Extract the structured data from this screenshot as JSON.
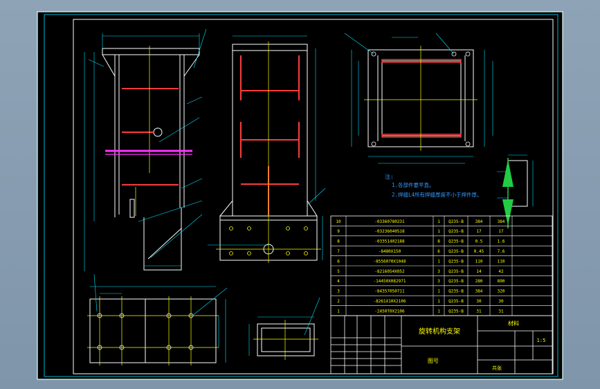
{
  "drawing": {
    "title_cn": "旋转机构支架",
    "drawing_no_label": "图号",
    "material_label": "材料",
    "scale_value": "1:5",
    "sheet_label": "共张",
    "notes_heading": "注:",
    "notes": [
      "1.各部件要平直。",
      "2.焊缝L4所有焊缝厚度不小于焊件厚。"
    ]
  },
  "colors": {
    "background": "#000000",
    "frame": "#ffffff",
    "border": "#00e5ff",
    "dims": "#00e5ff",
    "outline": "#ffffff",
    "centerline": "#ffff00",
    "hidden": "#ff3b3b",
    "note": "#3399ff",
    "highlight": "#ff33ff",
    "arrow": "#22cc44"
  },
  "bom": {
    "rows": [
      {
        "no": "10",
        "code": "-03360780231",
        "qty": "1",
        "mat": "Q235-B",
        "w1": "384",
        "w2": "384"
      },
      {
        "no": "9",
        "code": "-03236040518",
        "qty": "1",
        "mat": "Q235-B",
        "w1": "17",
        "w2": "17"
      },
      {
        "no": "8",
        "code": "-03351402188",
        "qty": "8",
        "mat": "Q235-B",
        "w1": "0.5",
        "w2": "1.6"
      },
      {
        "no": "7",
        "code": "-8480X150",
        "qty": "6",
        "mat": "Q235-B",
        "w1": "0.45",
        "w2": "7.6"
      },
      {
        "no": "6",
        "code": "-8556070X1048",
        "qty": "1",
        "mat": "Q235-B",
        "w1": "110",
        "w2": "110"
      },
      {
        "no": "5",
        "code": "-8216054X052",
        "qty": "3",
        "mat": "Q235-B",
        "w1": "14",
        "w2": "42"
      },
      {
        "no": "4",
        "code": "-14450X082971",
        "qty": "3",
        "mat": "Q235-B",
        "w1": "280",
        "w2": "890"
      },
      {
        "no": "3",
        "code": "-84357050711",
        "qty": "1",
        "mat": "Q235-B",
        "w1": "384",
        "w2": "320"
      },
      {
        "no": "2",
        "code": "-8261X10X2106",
        "qty": "1",
        "mat": "Q235-B",
        "w1": "30",
        "w2": "30"
      },
      {
        "no": "1",
        "code": "-2450T0X2106",
        "qty": "1",
        "mat": "Q235-B",
        "w1": "31",
        "w2": "31"
      }
    ]
  }
}
